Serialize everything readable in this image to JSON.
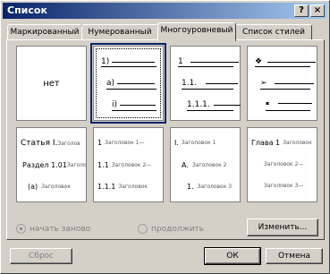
{
  "window": {
    "title": "Список",
    "help_glyph": "?",
    "close_glyph": "×"
  },
  "tabs": [
    {
      "label": "Маркированный"
    },
    {
      "label": "Нумерованный"
    },
    {
      "label": "Многоуровневый",
      "active": true
    },
    {
      "label": "Список стилей"
    }
  ],
  "styles": {
    "none": "нет",
    "s2": [
      "1)",
      "а)",
      "i)"
    ],
    "s3": [
      "1",
      "1.1.",
      "1.1.1."
    ],
    "s4": [
      "❖",
      "➢",
      "▪"
    ],
    "s5": [
      "Статья I.",
      "Раздел 1.01",
      "(а)"
    ],
    "s5_headings": [
      "Заголов",
      "Заголо",
      "Заголовок"
    ],
    "s6": [
      "1",
      "1.1",
      "1.1.1"
    ],
    "s6_headings": [
      "Заголовок 1—",
      "Заголовок 2—",
      "Заголовок"
    ],
    "s7": [
      "I.",
      "А.",
      "1."
    ],
    "s7_headings": [
      "Заголовок 1",
      "Заголовок 2",
      "Заголовок 3"
    ],
    "s8": [
      "Глава 1",
      "",
      ""
    ],
    "s8_headings": [
      "Заголовок",
      "Заголовок 2—",
      "Заголовок 3—"
    ]
  },
  "options": {
    "restart": "начать заново",
    "continue": "продолжить"
  },
  "buttons": {
    "change": "Изменить...",
    "reset": "Сброс",
    "ok": "ОК",
    "cancel": "Отмена"
  }
}
